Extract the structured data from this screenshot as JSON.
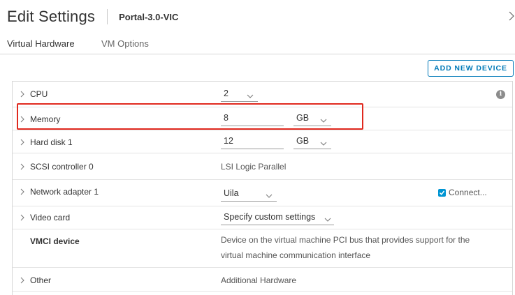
{
  "header": {
    "title": "Edit Settings",
    "vm_name": "Portal-3.0-VIC"
  },
  "tabs": [
    {
      "label": "Virtual Hardware",
      "active": true
    },
    {
      "label": "VM Options",
      "active": false
    }
  ],
  "toolbar": {
    "add_device_label": "ADD NEW DEVICE"
  },
  "hardware": {
    "cpu": {
      "label": "CPU",
      "value": "2"
    },
    "memory": {
      "label": "Memory",
      "value": "8",
      "unit": "GB"
    },
    "hard_disk": {
      "label": "Hard disk 1",
      "value": "12",
      "unit": "GB"
    },
    "scsi": {
      "label": "SCSI controller 0",
      "value": "LSI Logic Parallel"
    },
    "network": {
      "label": "Network adapter 1",
      "value": "Uila",
      "connect_label": "Connect...",
      "connected": true
    },
    "video": {
      "label": "Video card",
      "value": "Specify custom settings"
    },
    "vmci": {
      "label": "VMCI device",
      "description": "Device on the virtual machine PCI bus that provides support for the virtual machine communication interface"
    },
    "other": {
      "label": "Other",
      "value": "Additional Hardware"
    }
  },
  "colors": {
    "accent": "#0079b8",
    "highlight": "#e0291e",
    "checkbox": "#0095d3"
  },
  "icons": {
    "info": "info-icon",
    "expand": "chevron-right-icon",
    "dropdown": "chevron-down-icon",
    "close": "chevron-right-icon"
  }
}
